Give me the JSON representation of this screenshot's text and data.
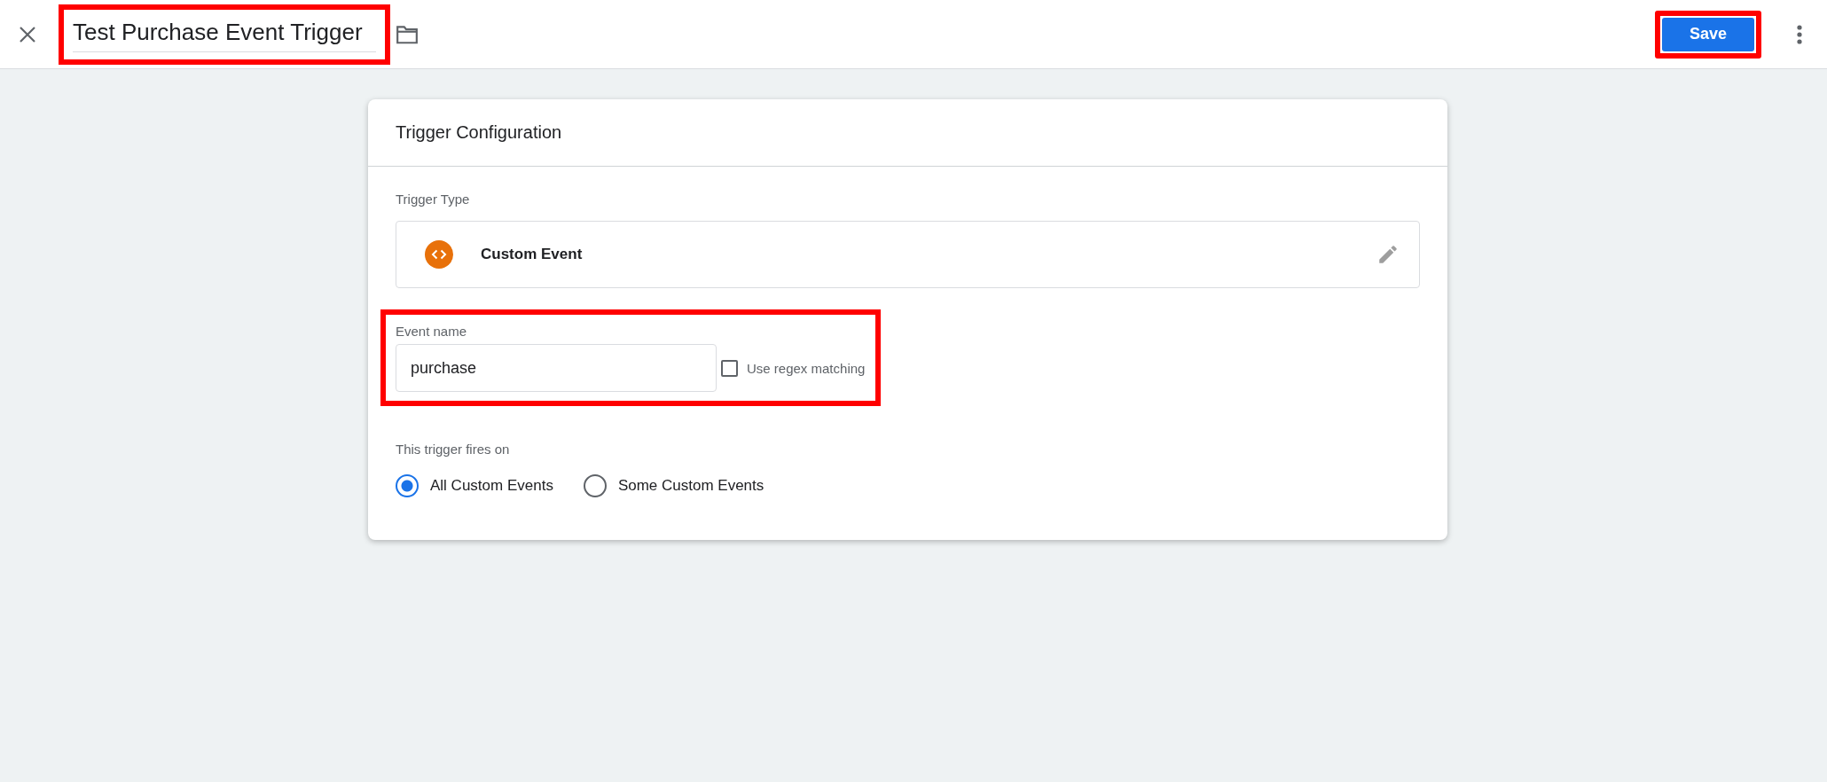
{
  "header": {
    "title": {
      "value": "Test Purchase Event Trigger",
      "highlighted": true
    },
    "save_button": {
      "label": "Save",
      "highlighted": true
    }
  },
  "card": {
    "title": "Trigger Configuration",
    "trigger_type": {
      "label": "Trigger Type",
      "value": "Custom Event"
    },
    "event_name": {
      "label": "Event name",
      "value": "purchase",
      "highlighted": true,
      "regex": {
        "label": "Use regex matching",
        "checked": false
      }
    },
    "fires_on": {
      "label": "This trigger fires on",
      "options": [
        {
          "label": "All Custom Events",
          "selected": true
        },
        {
          "label": "Some Custom Events",
          "selected": false
        }
      ]
    }
  }
}
